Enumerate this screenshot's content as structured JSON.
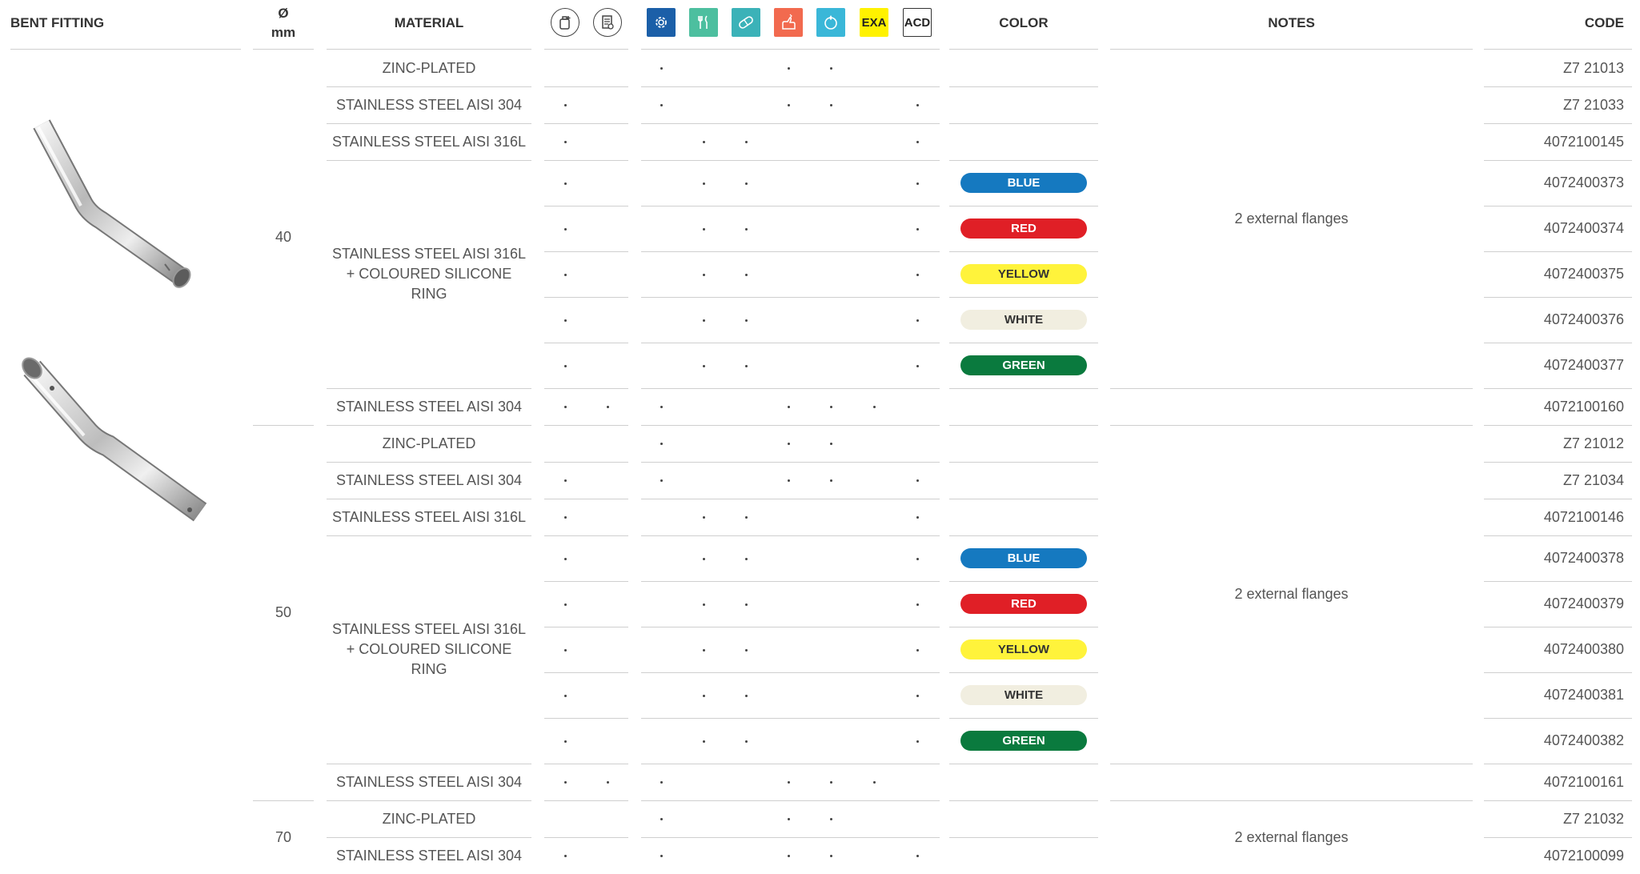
{
  "headers": {
    "bent_fitting": "BENT FITTING",
    "diameter_symbol": "Ø",
    "diameter_unit": "mm",
    "material": "MATERIAL",
    "color": "COLOR",
    "notes": "NOTES",
    "code": "CODE"
  },
  "icon_columns": [
    {
      "name": "container-add-icon",
      "style": "circle",
      "bg": "#ffffff"
    },
    {
      "name": "document-certificate-icon",
      "style": "circle",
      "bg": "#ffffff"
    },
    {
      "name": "gear-industrial-icon",
      "style": "square",
      "bg": "#1b5fa8"
    },
    {
      "name": "fork-knife-food-icon",
      "style": "square",
      "bg": "#4dbf9f"
    },
    {
      "name": "pill-pharma-icon",
      "style": "square",
      "bg": "#3bb2b8"
    },
    {
      "name": "hand-hazard-icon",
      "style": "square",
      "bg": "#f26a4f"
    },
    {
      "name": "water-drop-circle-icon",
      "style": "square",
      "bg": "#3ab7d8"
    },
    {
      "name": "exa-label-icon",
      "style": "text",
      "label": "EXA",
      "bg": "#fff200"
    },
    {
      "name": "acd-label-icon",
      "style": "text",
      "label": "ACD",
      "bg": "#ffffff"
    }
  ],
  "colors": {
    "BLUE": {
      "bg": "#1579c0",
      "fg": "#ffffff"
    },
    "RED": {
      "bg": "#e01f26",
      "fg": "#ffffff"
    },
    "YELLOW": {
      "bg": "#fff33b",
      "fg": "#333333"
    },
    "WHITE": {
      "bg": "#f1eee0",
      "fg": "#333333"
    },
    "GREEN": {
      "bg": "#0a7a3e",
      "fg": "#ffffff"
    }
  },
  "groups": [
    {
      "diameter": "40",
      "notes": "2 external flanges",
      "merged_material": "STAINLESS STEEL AISI 316L\n+ COLOURED SILICONE RING"
    },
    {
      "diameter": "50",
      "notes": "2 external flanges",
      "merged_material": "STAINLESS STEEL AISI 316L\n+ COLOURED SILICONE RING"
    },
    {
      "diameter": "70",
      "notes": "2 external flanges"
    }
  ],
  "rows": [
    {
      "material": "ZINC-PLATED",
      "dots": [
        0,
        0,
        1,
        0,
        0,
        1,
        1,
        0,
        0
      ],
      "color": "",
      "code": "Z7 21013"
    },
    {
      "material": "STAINLESS STEEL AISI 304",
      "dots": [
        1,
        0,
        1,
        0,
        0,
        1,
        1,
        0,
        1
      ],
      "color": "",
      "code": "Z7 21033"
    },
    {
      "material": "STAINLESS STEEL AISI 316L",
      "dots": [
        1,
        0,
        0,
        1,
        1,
        0,
        0,
        0,
        1
      ],
      "color": "",
      "code": "4072100145"
    },
    {
      "material": "",
      "dots": [
        1,
        0,
        0,
        1,
        1,
        0,
        0,
        0,
        1
      ],
      "color": "BLUE",
      "code": "4072400373"
    },
    {
      "material": "",
      "dots": [
        1,
        0,
        0,
        1,
        1,
        0,
        0,
        0,
        1
      ],
      "color": "RED",
      "code": "4072400374"
    },
    {
      "material": "",
      "dots": [
        1,
        0,
        0,
        1,
        1,
        0,
        0,
        0,
        1
      ],
      "color": "YELLOW",
      "code": "4072400375"
    },
    {
      "material": "",
      "dots": [
        1,
        0,
        0,
        1,
        1,
        0,
        0,
        0,
        1
      ],
      "color": "WHITE",
      "code": "4072400376"
    },
    {
      "material": "",
      "dots": [
        1,
        0,
        0,
        1,
        1,
        0,
        0,
        0,
        1
      ],
      "color": "GREEN",
      "code": "4072400377"
    },
    {
      "material": "STAINLESS STEEL AISI 304",
      "dots": [
        1,
        1,
        1,
        0,
        0,
        1,
        1,
        1,
        0
      ],
      "color": "",
      "code": "4072100160"
    },
    {
      "material": "ZINC-PLATED",
      "dots": [
        0,
        0,
        1,
        0,
        0,
        1,
        1,
        0,
        0
      ],
      "color": "",
      "code": "Z7 21012"
    },
    {
      "material": "STAINLESS STEEL AISI 304",
      "dots": [
        1,
        0,
        1,
        0,
        0,
        1,
        1,
        0,
        1
      ],
      "color": "",
      "code": "Z7 21034"
    },
    {
      "material": "STAINLESS STEEL AISI 316L",
      "dots": [
        1,
        0,
        0,
        1,
        1,
        0,
        0,
        0,
        1
      ],
      "color": "",
      "code": "4072100146"
    },
    {
      "material": "",
      "dots": [
        1,
        0,
        0,
        1,
        1,
        0,
        0,
        0,
        1
      ],
      "color": "BLUE",
      "code": "4072400378"
    },
    {
      "material": "",
      "dots": [
        1,
        0,
        0,
        1,
        1,
        0,
        0,
        0,
        1
      ],
      "color": "RED",
      "code": "4072400379"
    },
    {
      "material": "",
      "dots": [
        1,
        0,
        0,
        1,
        1,
        0,
        0,
        0,
        1
      ],
      "color": "YELLOW",
      "code": "4072400380"
    },
    {
      "material": "",
      "dots": [
        1,
        0,
        0,
        1,
        1,
        0,
        0,
        0,
        1
      ],
      "color": "WHITE",
      "code": "4072400381"
    },
    {
      "material": "",
      "dots": [
        1,
        0,
        0,
        1,
        1,
        0,
        0,
        0,
        1
      ],
      "color": "GREEN",
      "code": "4072400382"
    },
    {
      "material": "STAINLESS STEEL AISI 304",
      "dots": [
        1,
        1,
        1,
        0,
        0,
        1,
        1,
        1,
        0
      ],
      "color": "",
      "code": "4072100161"
    },
    {
      "material": "ZINC-PLATED",
      "dots": [
        0,
        0,
        1,
        0,
        0,
        1,
        1,
        0,
        0
      ],
      "color": "",
      "code": "Z7 21032"
    },
    {
      "material": "STAINLESS STEEL AISI 304",
      "dots": [
        1,
        0,
        1,
        0,
        0,
        1,
        1,
        0,
        1
      ],
      "color": "",
      "code": "4072100099"
    }
  ]
}
